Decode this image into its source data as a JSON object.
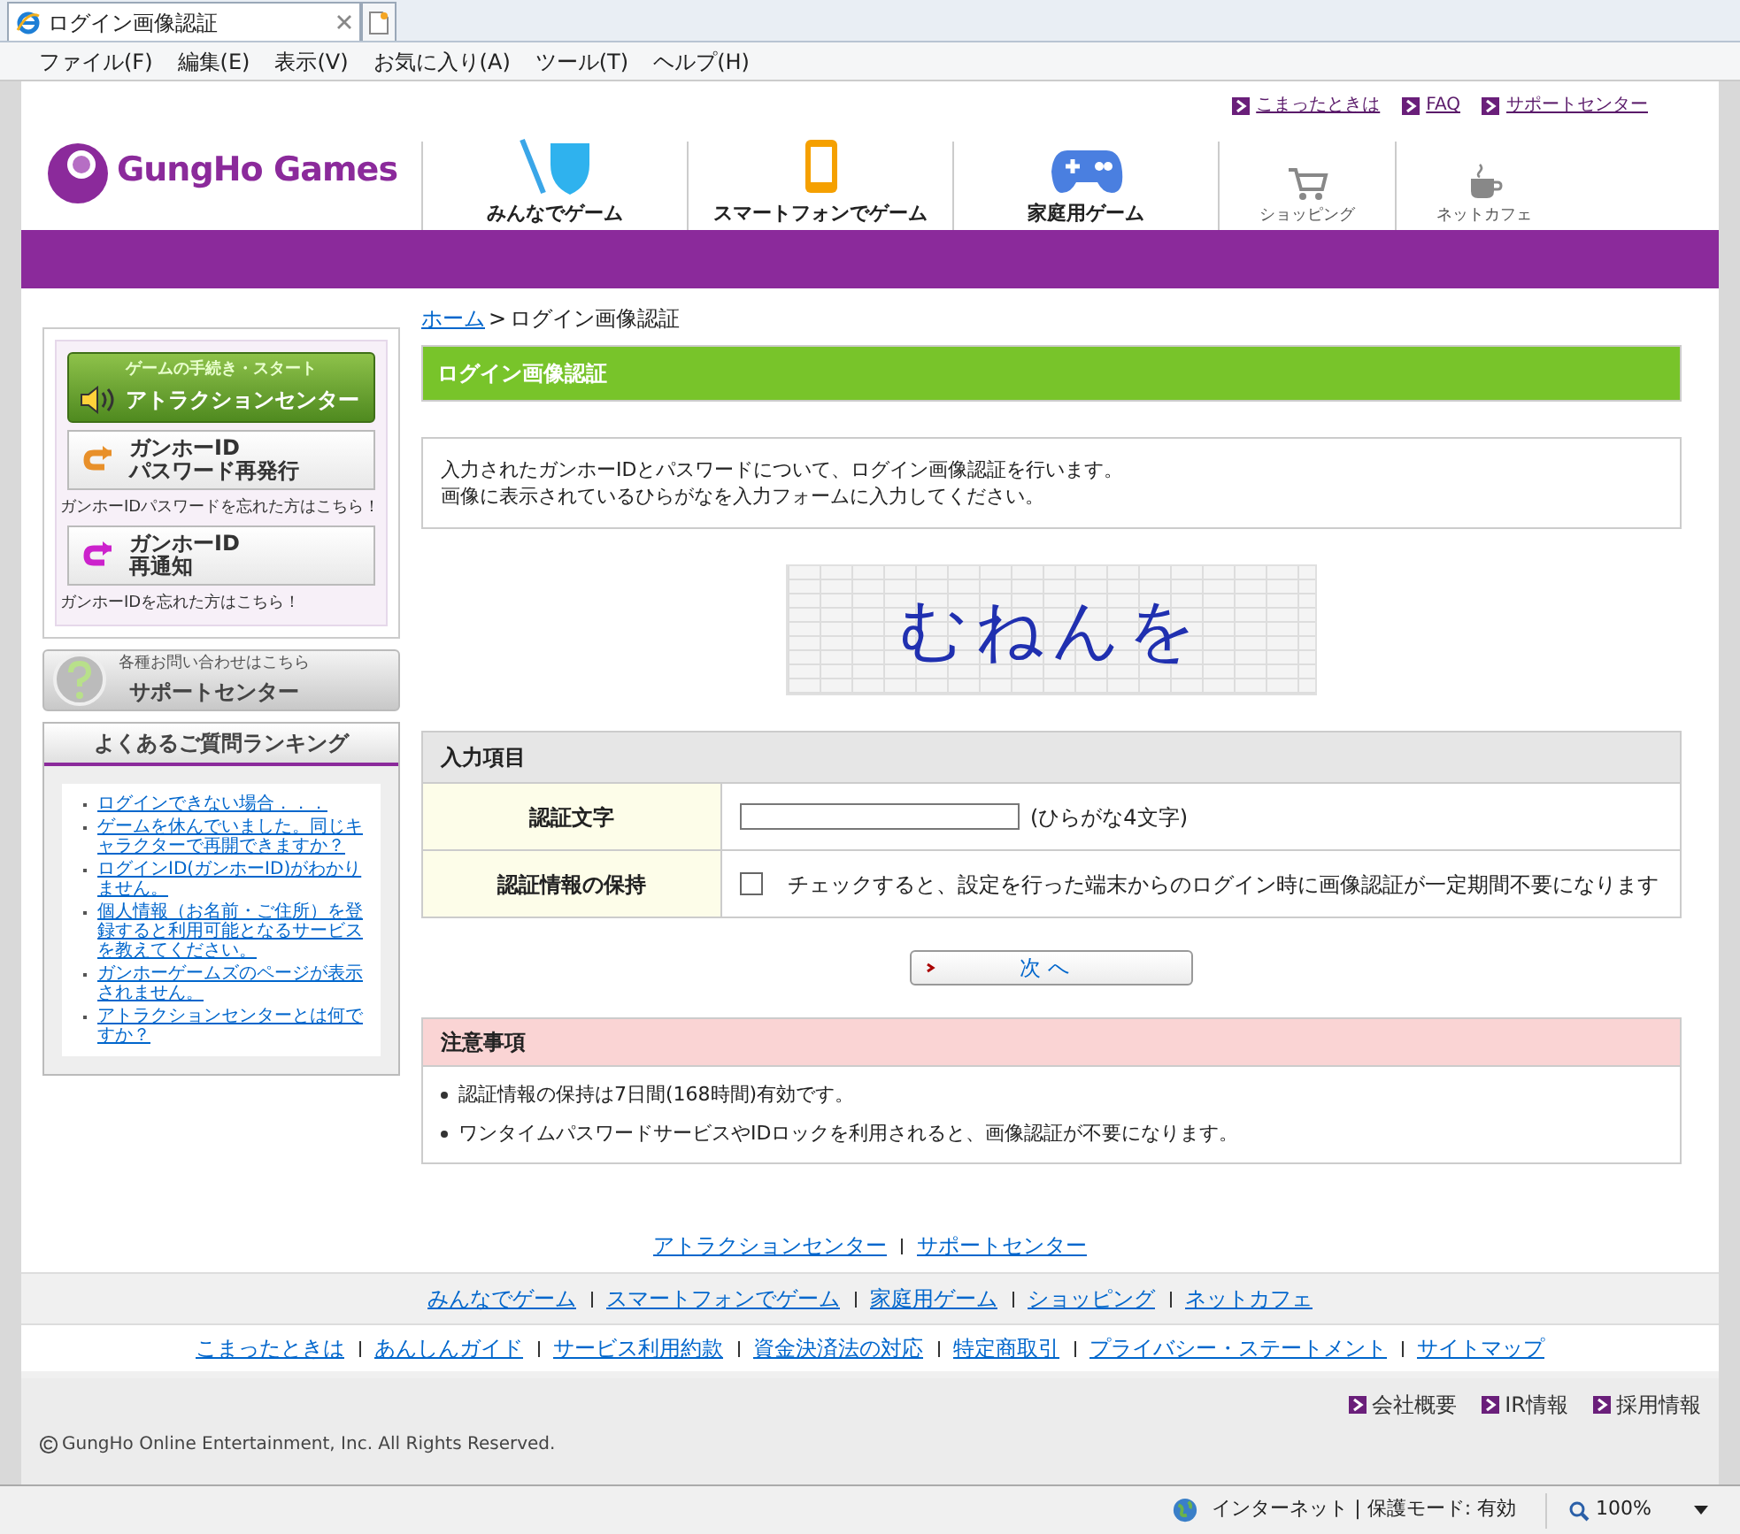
{
  "browser": {
    "tab_title": "ログイン画像認証",
    "menu": [
      "ファイル(F)",
      "編集(E)",
      "表示(V)",
      "お気に入り(A)",
      "ツール(T)",
      "ヘルプ(H)"
    ],
    "status_zone": "インターネット | 保護モード: 有効",
    "zoom": "100%"
  },
  "header": {
    "top_links": [
      "こまったときは",
      "FAQ",
      "サポートセンター"
    ],
    "logo": "GungHo Games",
    "nav": [
      {
        "label": "みんなでゲーム",
        "kind": "sword"
      },
      {
        "label": "スマートフォンでゲーム",
        "kind": "phone"
      },
      {
        "label": "家庭用ゲーム",
        "kind": "gamepad"
      },
      {
        "label": "ショッピング",
        "kind": "cart"
      },
      {
        "label": "ネットカフェ",
        "kind": "cup"
      }
    ]
  },
  "sidebar": {
    "attraction": {
      "caption": "ゲームの手続き・スタート",
      "label": "アトラクションセンター"
    },
    "id_buttons": [
      {
        "title": "ガンホーID",
        "subtitle": "パスワード再発行",
        "note": "ガンホーIDパスワードを忘れた方はこちら！",
        "color": "#e8902a"
      },
      {
        "title": "ガンホーID",
        "subtitle": "再通知",
        "note": "ガンホーIDを忘れた方はこちら！",
        "color": "#cc22cc"
      }
    ],
    "support": {
      "caption": "各種お問い合わせはこちら",
      "label": "サポートセンター"
    },
    "faq": {
      "title": "よくあるご質問ランキング",
      "items": [
        "ログインできない場合．．．",
        "ゲームを休んでいました。同じキャラクターで再開できますか？",
        "ログインID(ガンホーID)がわかりません。",
        "個人情報（お名前・ご住所）を登録すると利用可能となるサービスを教えてください。",
        "ガンホーゲームズのページが表示されません。",
        "アトラクションセンターとは何ですか？"
      ]
    }
  },
  "main": {
    "breadcrumb": [
      {
        "label": "ホーム",
        "link": true
      },
      {
        "label": "ログイン画像認証",
        "link": false
      }
    ],
    "breadcrumb_sep": ">",
    "title": "ログイン画像認証",
    "intro": [
      "入力されたガンホーIDとパスワードについて、ログイン画像認証を行います。",
      "画像に表示されているひらがなを入力フォームに入力してください。"
    ],
    "captcha": "むねんを",
    "form": {
      "heading": "入力項目",
      "rows": [
        {
          "label": "認証文字",
          "kind": "text",
          "note": "(ひらがな4文字)"
        },
        {
          "label": "認証情報の保持",
          "kind": "checkbox",
          "checked": false,
          "note": "チェックすると、設定を行った端末からのログイン時に画像認証が一定期間不要になります"
        }
      ]
    },
    "next_button": "次 へ",
    "notes": {
      "heading": "注意事項",
      "items": [
        "認証情報の保持は7日間(168時間)有効です。",
        "ワンタイムパスワードサービスやIDロックを利用されると、画像認証が不要になります。"
      ]
    }
  },
  "footer": {
    "links_1": [
      "アトラクションセンター",
      "サポートセンター"
    ],
    "links_2": [
      "みんなでゲーム",
      "スマートフォンでゲーム",
      "家庭用ゲーム",
      "ショッピング",
      "ネットカフェ"
    ],
    "links_3": [
      "こまったときは",
      "あんしんガイド",
      "サービス利用約款",
      "資金決済法の対応",
      "特定商取引",
      "プライバシー・ステートメント",
      "サイトマップ"
    ],
    "corporate": [
      "会社概要",
      "IR情報",
      "採用情報"
    ],
    "copyright": "GungHo Online Entertainment, Inc. All Rights Reserved."
  }
}
